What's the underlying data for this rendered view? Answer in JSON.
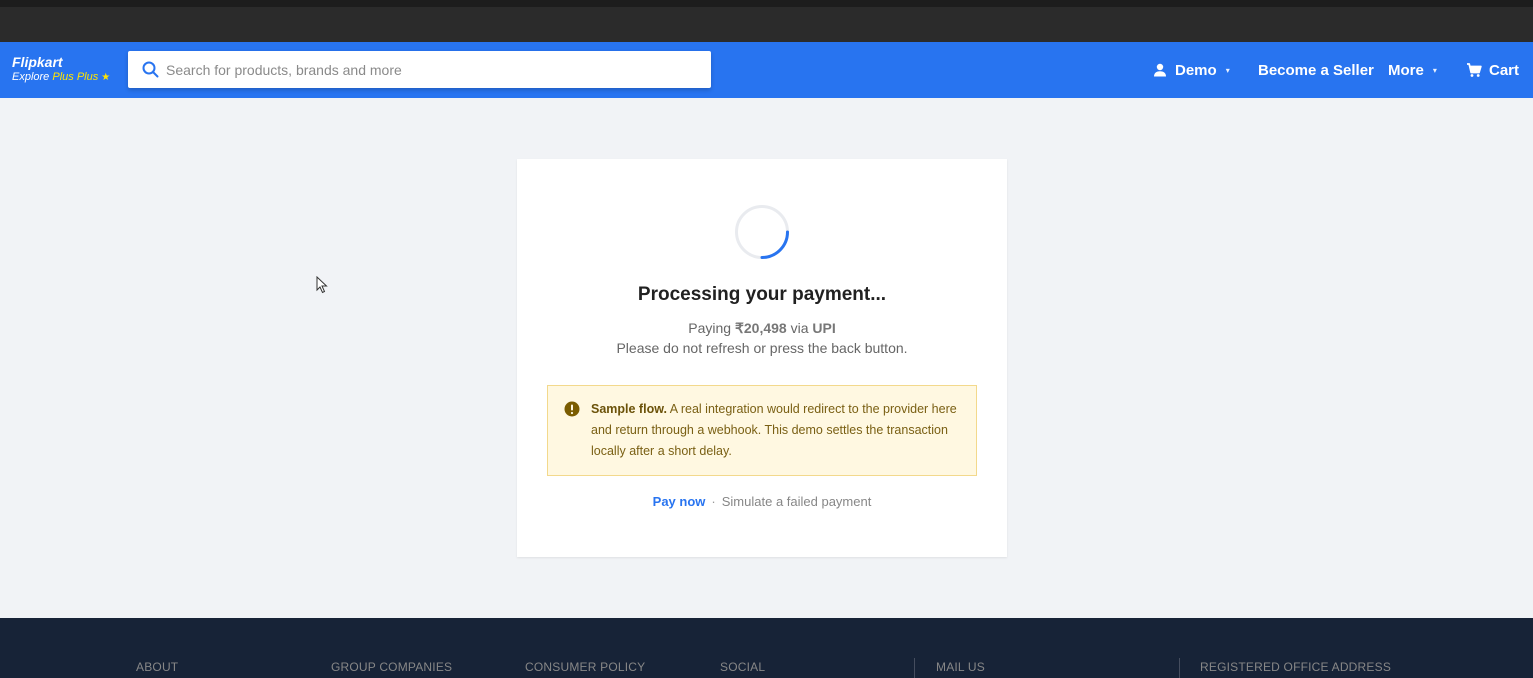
{
  "header": {
    "logo": {
      "name": "Flipkart",
      "tagline": "Explore",
      "plus": "Plus",
      "star": "★"
    },
    "search": {
      "placeholder": "Search for products, brands and more"
    },
    "account": {
      "label": "Demo"
    },
    "seller": {
      "label": "Become a Seller"
    },
    "more": {
      "label": "More"
    },
    "cart": {
      "label": "Cart"
    },
    "caret": "▾"
  },
  "payment": {
    "title": "Processing your payment...",
    "paying_prefix": "Paying ",
    "amount": "₹20,498",
    "via": " via ",
    "method": "UPI",
    "note": "Please do not refresh or press the back button.",
    "alert": {
      "title": "Sample flow.",
      "body": " A real integration would redirect to the provider here and return through a webhook. This demo settles the transaction locally after a short delay."
    },
    "actions": {
      "pay_now": "Pay now",
      "separator": "·",
      "simulate_failure": "Simulate a failed payment"
    }
  },
  "footer": {
    "columns": [
      "ABOUT",
      "GROUP COMPANIES",
      "CONSUMER POLICY",
      "SOCIAL",
      "MAIL US",
      "REGISTERED OFFICE ADDRESS"
    ]
  },
  "colors": {
    "brand": "#2874f0",
    "accent": "#ffe500",
    "footer": "#172337",
    "alert_bg": "#fff8e1"
  }
}
